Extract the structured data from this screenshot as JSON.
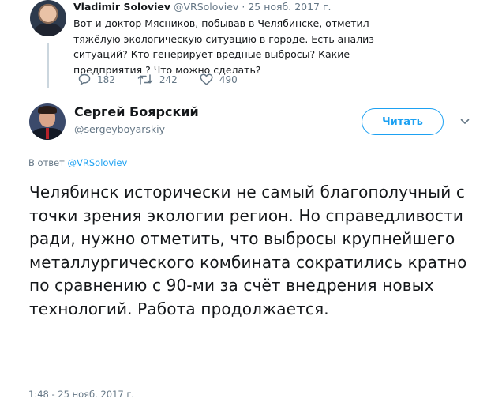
{
  "parent_tweet": {
    "name": "Vladimir Soloviev",
    "handle": "@VRSoloviev",
    "separator": "·",
    "date": "25 нояб. 2017 г.",
    "text": "Вот и доктор Мясников, побывав в Челябинске, отметил тяжёлую экологическую ситуацию в городе. Есть анализ ситуаций? Кто генерирует вредные выбросы? Какие предприятия ? Что можно сделать?",
    "replies": "182",
    "retweets": "242",
    "likes": "490",
    "icons": [
      "reply-icon",
      "retweet-icon",
      "like-icon"
    ]
  },
  "reply_tweet": {
    "name": "Сергей Боярский",
    "handle": "@sergeyboyarskiy",
    "follow_label": "Читать",
    "reply_to_prefix": "В ответ",
    "reply_to_mention": "@VRSoloviev",
    "text": "Челябинск исторически не самый благополучный с точки зрения экологии регион. Но справедливости ради, нужно отметить, что выбросы крупнейшего металлургического комбината сократились кратно по сравнению с 90-ми за счёт внедрения новых технологий. Работа продолжается.",
    "timestamp": "1:48 - 25 нояб. 2017 г."
  },
  "colors": {
    "accent": "#1da1f2",
    "secondary_text": "#657786",
    "primary_text": "#14171a"
  }
}
